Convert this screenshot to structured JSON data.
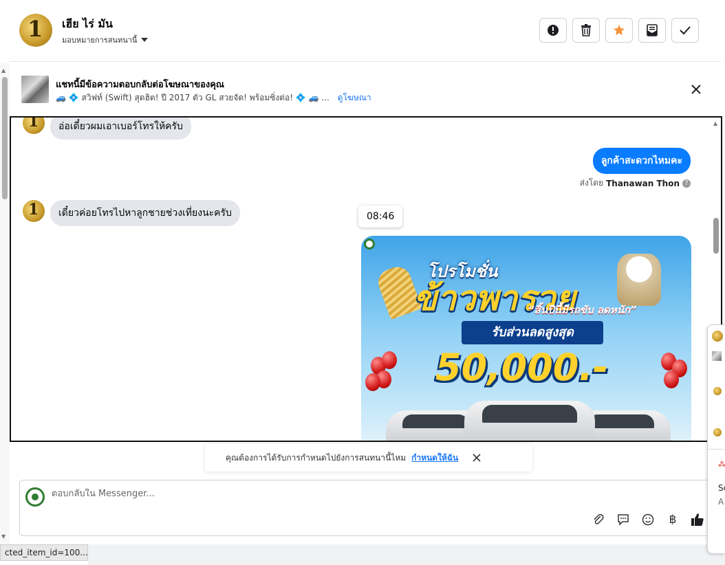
{
  "header": {
    "avatar_glyph": "1",
    "contact_name": "เฮีย ไร่ มัน",
    "assign_label": "มอบหมายการสนทนานี้",
    "actions": [
      {
        "name": "report-icon"
      },
      {
        "name": "trash-icon"
      },
      {
        "name": "star-icon",
        "color": "#f7923a"
      },
      {
        "name": "mark-unread-icon"
      },
      {
        "name": "checkmark-icon"
      }
    ]
  },
  "ad_banner": {
    "title": "แชทนี้มีข้อความตอบกลับต่อโฆษณาของคุณ",
    "subtitle": "🚙 💠 สวิฟท์ (Swift) สุดฮิต! ปี 2017 ตัว GL สวยจัด! พร้อมซิ่งต่อ! 💠 🚙 ...",
    "link": "ดูโฆษณา"
  },
  "messages": {
    "incoming_1": "อ่อเดี๋ยวผมเอาเบอร์โทรให้ครับ",
    "outgoing_1": "ลูกค้าสะดวกไหมคะ",
    "sent_by_label": "ส่งโดย",
    "sent_by_name": "Thanawan Thon",
    "incoming_2": "เดี๋ยวค่อยโทรไปหาลูกชายช่วงเที่ยงนะครับ",
    "timestamp": "08:46"
  },
  "promo": {
    "line1": "โปรโมชั่น",
    "line2": "ข้าวพารวย",
    "tagline": "“สิ้นปีนี้มีรถขับ ลดหนัก”",
    "band": "รับส่วนลดสูงสุด",
    "amount": "50,000.-"
  },
  "notice": {
    "text": "คุณต้องการได้รับการกำหนดไปยังการสนทนานี้ไหม",
    "link": "กำหนดให้ฉัน"
  },
  "composer": {
    "placeholder": "ตอบกลับใน Messenger...",
    "baht_glyph": "฿"
  },
  "status_bar": {
    "text": "cted_item_id=100..."
  },
  "side_popup": {
    "text_1": "Sc",
    "text_2": "A"
  },
  "colors": {
    "accent": "#1877f2",
    "outgoing_bubble": "#0a7cff",
    "incoming_bubble": "#e4e6eb"
  }
}
